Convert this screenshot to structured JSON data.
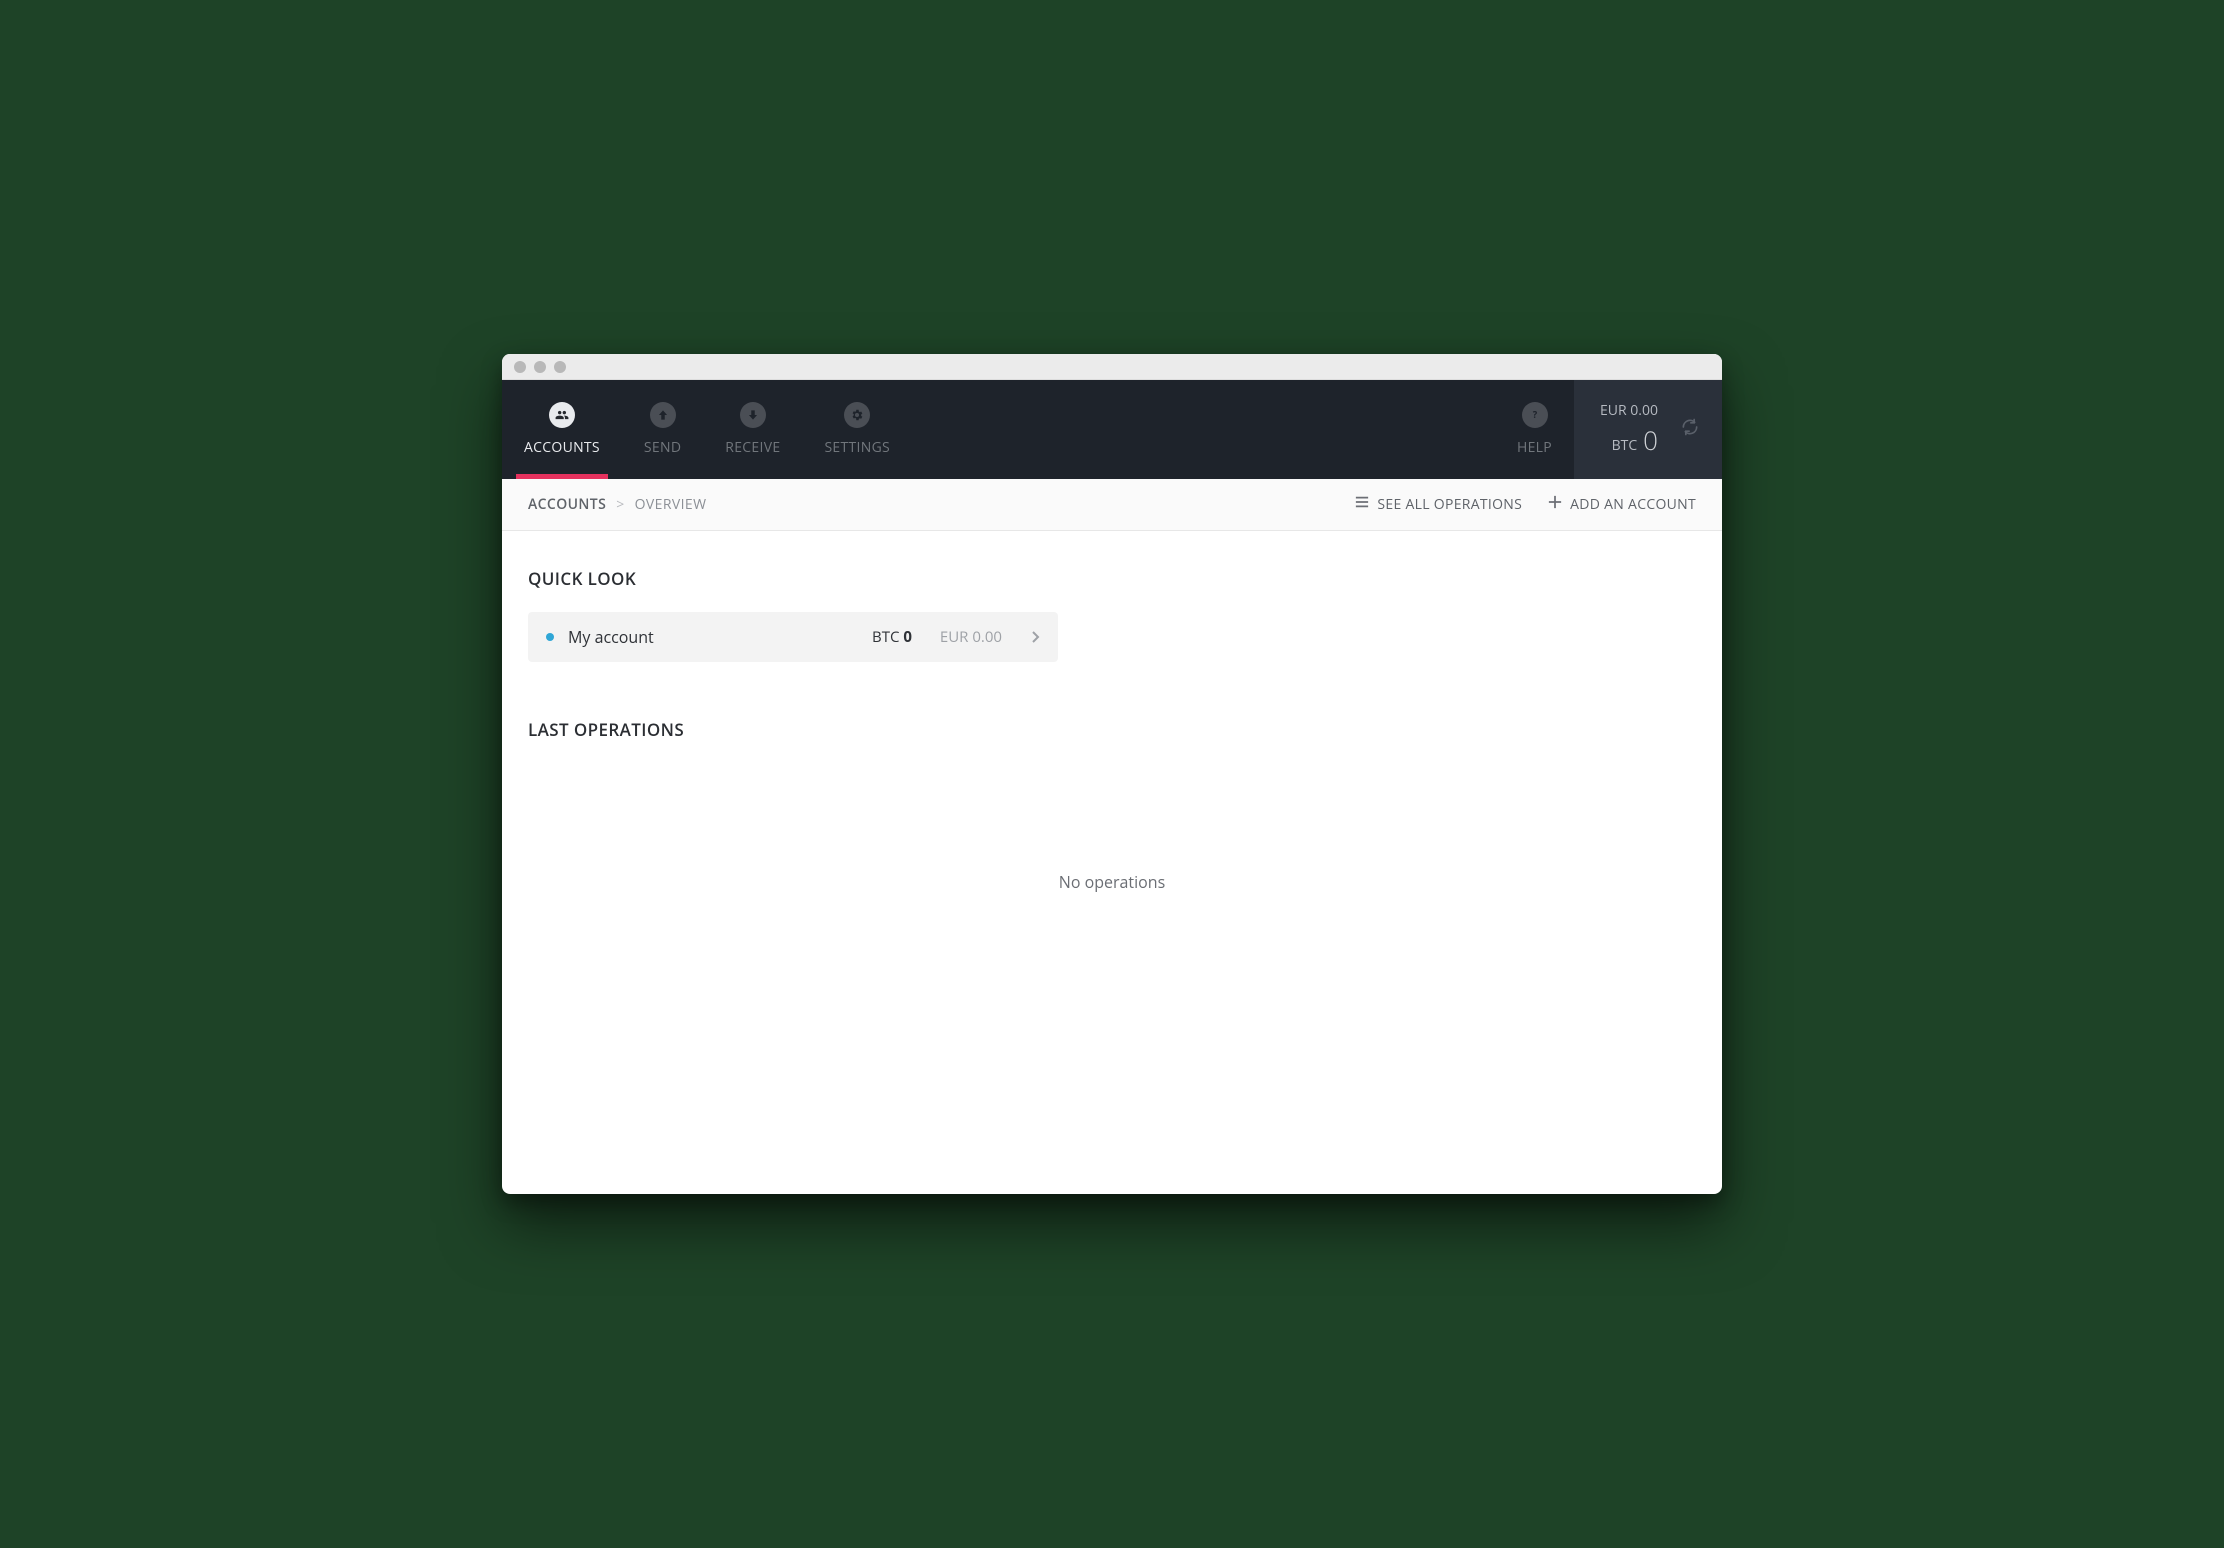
{
  "nav": {
    "accounts": "ACCOUNTS",
    "send": "SEND",
    "receive": "RECEIVE",
    "settings": "SETTINGS",
    "help": "HELP"
  },
  "balance": {
    "eur_label": "EUR",
    "eur_value": "0.00",
    "btc_label": "BTC",
    "btc_value": "0"
  },
  "breadcrumb": {
    "root": "ACCOUNTS",
    "current": "OVERVIEW"
  },
  "subheader": {
    "see_all": "SEE ALL OPERATIONS",
    "add_account": "ADD AN ACCOUNT"
  },
  "sections": {
    "quick_look": "QUICK LOOK",
    "last_operations": "LAST OPERATIONS"
  },
  "account": {
    "name": "My account",
    "btc_label": "BTC",
    "btc_value": "0",
    "eur_label": "EUR",
    "eur_value": "0.00"
  },
  "empty": {
    "no_operations": "No operations"
  }
}
